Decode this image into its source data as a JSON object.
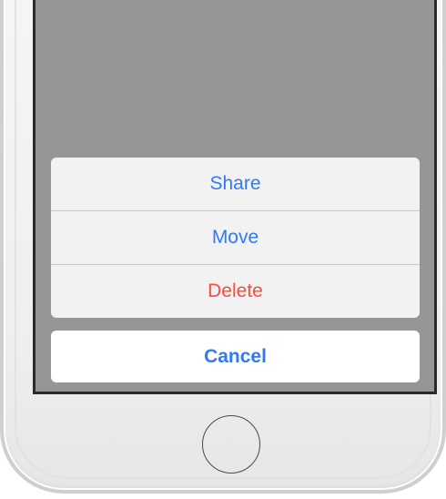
{
  "action_sheet": {
    "actions": [
      {
        "label": "Share",
        "style": "default"
      },
      {
        "label": "Move",
        "style": "default"
      },
      {
        "label": "Delete",
        "style": "destructive"
      }
    ],
    "cancel_label": "Cancel"
  },
  "device": {
    "home_button_icon": "home-button-icon"
  },
  "colors": {
    "accent": "#2f7bf5",
    "destructive": "#fc4a40",
    "dimmed_screen": "#969696",
    "sheet_background": "#f2f2f2"
  }
}
